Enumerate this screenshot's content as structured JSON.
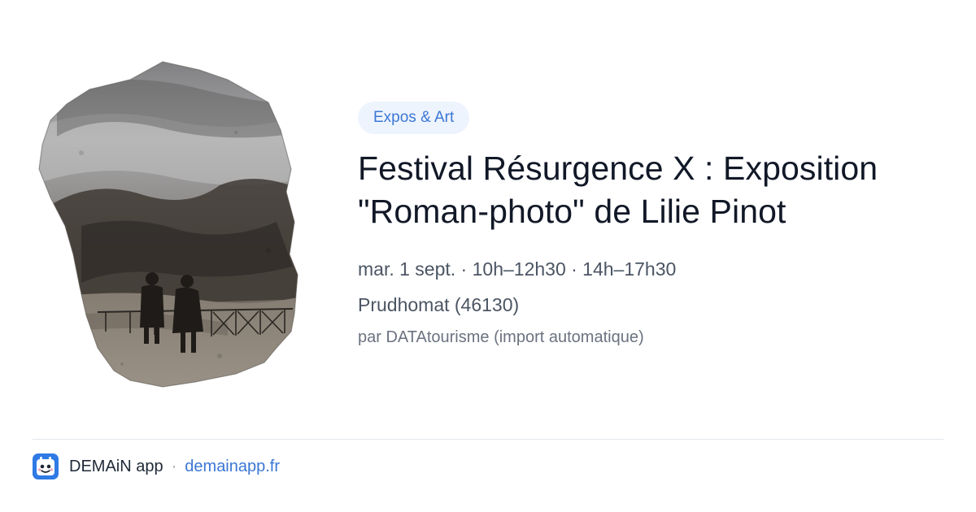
{
  "event": {
    "category": "Expos & Art",
    "title": "Festival Résurgence X : Exposition \"Roman-photo\" de Lilie Pinot",
    "datetime": "mar. 1 sept. · 10h–12h30 · 14h–17h30",
    "location": "Prudhomat (46130)",
    "source": "par DATAtourisme (import automatique)"
  },
  "footer": {
    "app_name": "DEMAiN app",
    "separator": "·",
    "link": "demainapp.fr"
  },
  "colors": {
    "accent": "#3b77d6",
    "pill_bg": "#eef4fd",
    "title": "#111827",
    "meta": "#4b5563",
    "muted": "#6b7280",
    "divider": "#e3e7ec"
  }
}
